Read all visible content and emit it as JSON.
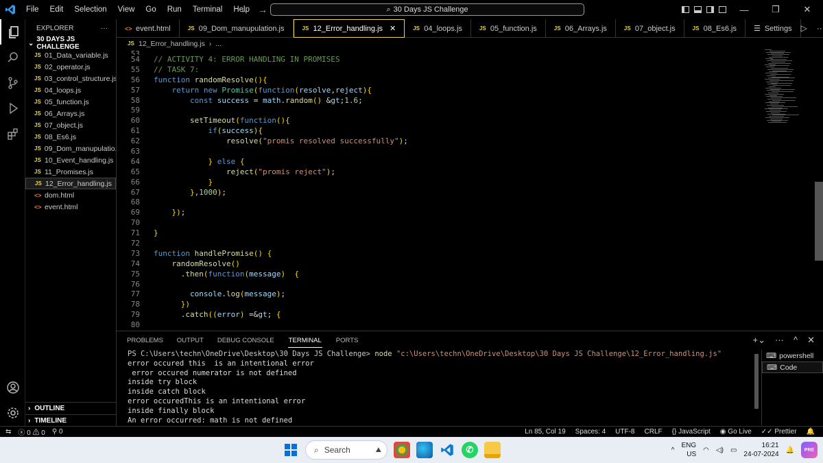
{
  "titlebar": {
    "menu": [
      "File",
      "Edit",
      "Selection",
      "View",
      "Go",
      "Run",
      "Terminal",
      "Help"
    ],
    "search": "30 Days JS Challenge"
  },
  "explorer": {
    "header": "EXPLORER",
    "folder": "30 DAYS JS CHALLENGE",
    "files": [
      {
        "type": "js",
        "name": "01_Data_variable.js"
      },
      {
        "type": "js",
        "name": "02_operator.js"
      },
      {
        "type": "js",
        "name": "03_control_structure.js"
      },
      {
        "type": "js",
        "name": "04_loops.js"
      },
      {
        "type": "js",
        "name": "05_function.js"
      },
      {
        "type": "js",
        "name": "06_Arrays.js"
      },
      {
        "type": "js",
        "name": "07_object.js"
      },
      {
        "type": "js",
        "name": "08_Es6.js"
      },
      {
        "type": "js",
        "name": "09_Dom_manupulatio..."
      },
      {
        "type": "js",
        "name": "10_Event_handling.js"
      },
      {
        "type": "js",
        "name": "11_Promises.js"
      },
      {
        "type": "js",
        "name": "12_Error_handling.js"
      },
      {
        "type": "html",
        "name": "dom.html"
      },
      {
        "type": "html",
        "name": "event.html"
      }
    ],
    "outline": "OUTLINE",
    "timeline": "TIMELINE"
  },
  "tabs": [
    {
      "type": "html",
      "name": "event.html"
    },
    {
      "type": "js",
      "name": "09_Dom_manupulation.js"
    },
    {
      "type": "js",
      "name": "12_Error_handling.js",
      "active": true
    },
    {
      "type": "js",
      "name": "04_loops.js"
    },
    {
      "type": "js",
      "name": "05_function.js"
    },
    {
      "type": "js",
      "name": "06_Arrays.js"
    },
    {
      "type": "js",
      "name": "07_object.js"
    },
    {
      "type": "js",
      "name": "08_Es6.js"
    },
    {
      "type": "settings",
      "name": "Settings"
    }
  ],
  "breadcrumb": {
    "file": "12_Error_handling.js",
    "rest": "..."
  },
  "editor": {
    "lines": [
      {
        "n": "53",
        "t": ""
      },
      {
        "n": "54",
        "t": "// ACTIVITY 4: ERROR HANDLING IN PROMISES"
      },
      {
        "n": "55",
        "t": "// TASK 7:"
      },
      {
        "n": "56",
        "t": "function randomResolve(){"
      },
      {
        "n": "57",
        "t": "    return new Promise(function(resolve,reject){"
      },
      {
        "n": "58",
        "t": "        const success = math.random() >1.6;"
      },
      {
        "n": "59",
        "t": ""
      },
      {
        "n": "60",
        "t": "        setTimeout(function(){"
      },
      {
        "n": "61",
        "t": "            if(success){"
      },
      {
        "n": "62",
        "t": "                resolve(\"promis resolved successfully\");"
      },
      {
        "n": "63",
        "t": ""
      },
      {
        "n": "64",
        "t": "            } else {"
      },
      {
        "n": "65",
        "t": "                reject(\"promis reject\");"
      },
      {
        "n": "66",
        "t": "            }"
      },
      {
        "n": "67",
        "t": "        },1000);"
      },
      {
        "n": "68",
        "t": ""
      },
      {
        "n": "69",
        "t": "    });"
      },
      {
        "n": "70",
        "t": ""
      },
      {
        "n": "71",
        "t": "}"
      },
      {
        "n": "72",
        "t": ""
      },
      {
        "n": "73",
        "t": "function handlePromise() {"
      },
      {
        "n": "74",
        "t": "    randomResolve()"
      },
      {
        "n": "75",
        "t": "      .then(function(message)  {"
      },
      {
        "n": "76",
        "t": ""
      },
      {
        "n": "77",
        "t": "        console.log(message);"
      },
      {
        "n": "78",
        "t": "      })"
      },
      {
        "n": "79",
        "t": "      .catch((error) => {"
      },
      {
        "n": "80",
        "t": ""
      }
    ]
  },
  "panel": {
    "tabs": [
      "PROBLEMS",
      "OUTPUT",
      "DEBUG CONSOLE",
      "TERMINAL",
      "PORTS"
    ],
    "active_tab": "TERMINAL",
    "prompt": "PS C:\\Users\\techn\\OneDrive\\Desktop\\30 Days JS Challenge>",
    "command": "node",
    "command_arg": "\"c:\\Users\\techn\\OneDrive\\Desktop\\30 Days JS Challenge\\12_Error_handling.js\"",
    "output": [
      "error occured this  is an intentional error",
      " error occured numerator is not defined",
      "inside try block",
      "inside catch block",
      "error occuredThis is an intentional error",
      "inside finally block",
      "An error occurred: math is not defined"
    ],
    "terminals": [
      "powershell",
      "Code"
    ]
  },
  "statusbar": {
    "errors": "0",
    "warnings": "0",
    "ports": "0",
    "position": "Ln 85, Col 19",
    "spaces": "Spaces: 4",
    "encoding": "UTF-8",
    "eol": "CRLF",
    "language": "JavaScript",
    "golive": "Go Live",
    "prettier": "Prettier"
  },
  "taskbar": {
    "search": "Search",
    "lang1": "ENG",
    "lang2": "US",
    "time": "16:21",
    "date": "24-07-2024"
  }
}
